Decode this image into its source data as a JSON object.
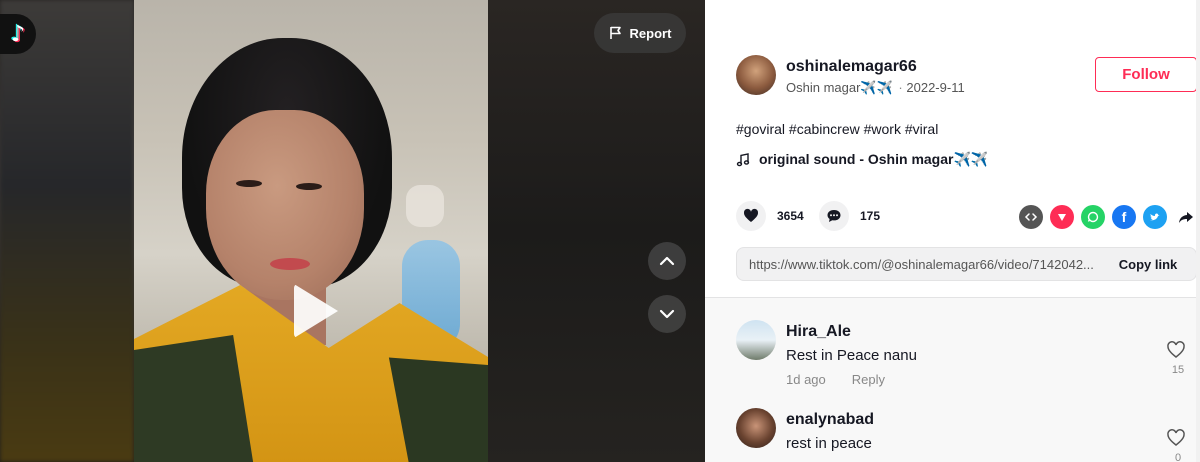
{
  "video": {
    "report_label": "Report"
  },
  "author": {
    "username": "oshinalemagar66",
    "display_name": "Oshin magar✈️✈️",
    "date": "2022-9-11",
    "follow_label": "Follow"
  },
  "post": {
    "caption": "#goviral #cabincrew #work #viral",
    "sound": "original sound - Oshin magar✈️✈️"
  },
  "stats": {
    "likes": "3654",
    "comments": "175"
  },
  "share": {
    "icons": [
      "embed-icon",
      "send-icon",
      "whatsapp-icon",
      "facebook-icon",
      "twitter-icon",
      "share-arrow-icon"
    ],
    "link": "https://www.tiktok.com/@oshinalemagar66/video/7142042...",
    "copy_label": "Copy link"
  },
  "comments": [
    {
      "user": "Hira_Ale",
      "text": "Rest in Peace nanu",
      "time": "1d ago",
      "reply_label": "Reply",
      "likes": "15"
    },
    {
      "user": "enalynabad",
      "text": "rest in peace",
      "time": "",
      "reply_label": "",
      "likes": "0"
    }
  ],
  "colors": {
    "accent": "#fe2c55",
    "whatsapp": "#25d366",
    "facebook": "#1877f2",
    "twitter": "#1da1f2",
    "embed": "#555555"
  }
}
